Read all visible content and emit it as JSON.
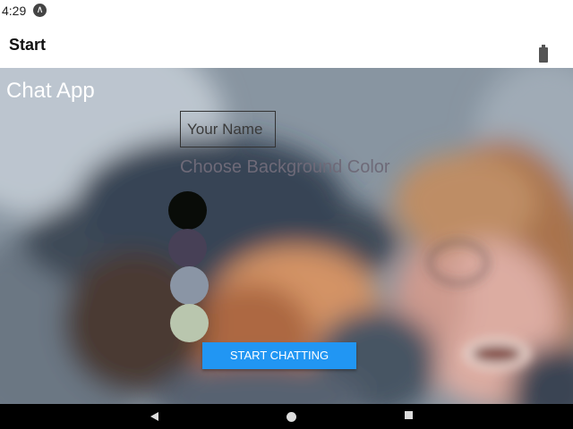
{
  "status_bar": {
    "time": "4:29",
    "app_icon": "launcher-icon",
    "battery_icon": "battery-icon"
  },
  "appbar": {
    "title": "Start"
  },
  "start_screen": {
    "app_title": "Chat App",
    "name_input": {
      "placeholder": "Your Name",
      "value": ""
    },
    "choose_label": "Choose Background Color",
    "swatches": [
      {
        "color": "#090C08"
      },
      {
        "color": "#474056"
      },
      {
        "color": "#8A95A5"
      },
      {
        "color": "#B9C6AE"
      }
    ],
    "start_button": {
      "label": "START CHATTING",
      "color": "#2196F3"
    }
  },
  "nav_bar": {
    "back": "back-icon",
    "home": "home-icon",
    "recents": "recents-icon"
  }
}
